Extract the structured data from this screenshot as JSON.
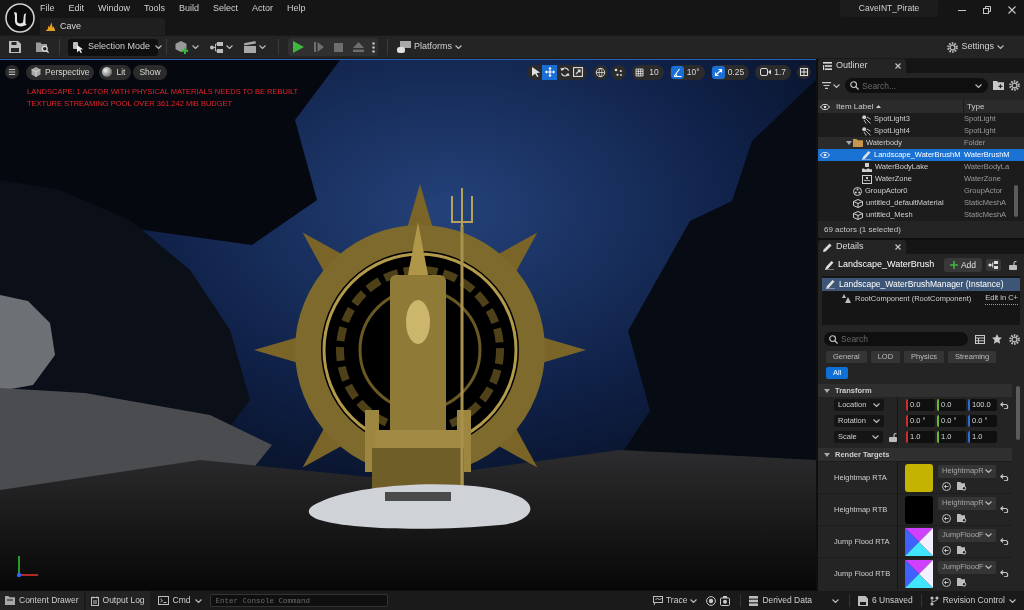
{
  "menu_bar": [
    "File",
    "Edit",
    "Window",
    "Tools",
    "Build",
    "Select",
    "Actor",
    "Help"
  ],
  "document_tab": {
    "label": "Cave"
  },
  "project_name": "CaveINT_Pirate",
  "main_toolbar": {
    "mode_dropdown": "Selection Mode",
    "play_controls": [
      {
        "kind": "play",
        "disabled": false
      },
      {
        "kind": "advance",
        "disabled": true
      },
      {
        "kind": "stop",
        "disabled": true
      },
      {
        "kind": "eject",
        "disabled": true
      }
    ],
    "platforms_button": "Platforms",
    "settings_button": "Settings"
  },
  "viewport": {
    "view_button": "Perspective",
    "lighting_button": "Lit",
    "show_button": "Show",
    "transform_tools": [
      {
        "kind": "select",
        "selected": false
      },
      {
        "kind": "translate",
        "selected": true
      },
      {
        "kind": "rotate",
        "selected": false
      },
      {
        "kind": "scale",
        "selected": false
      }
    ],
    "snaps": [
      {
        "kind": "grid",
        "value": "10",
        "on": false
      },
      {
        "kind": "rotation",
        "value": "10°",
        "on": true
      },
      {
        "kind": "scale",
        "value": "0.25",
        "on": true
      }
    ],
    "camera_speed": "1.7",
    "messages": [
      "LANDSCAPE: 1 ACTOR WITH PHYSICAL MATERIALS NEEDS TO BE REBUILT",
      "TEXTURE STREAMING POOL OVER 361.242 MiB BUDGET"
    ]
  },
  "outliner": {
    "tab": "Outliner",
    "search": {
      "placeholder": "Search..."
    },
    "columns": [
      "Item Label",
      "Type"
    ],
    "rows": [
      {
        "children": [
          {
            "label": "SpotLight3",
            "type": "SpotLight",
            "kind": "light",
            "selected": false
          },
          {
            "label": "SpotLight4",
            "type": "SpotLight",
            "kind": "light",
            "selected": false
          }
        ]
      },
      {
        "label": "Waterbody",
        "type": "Folder",
        "kind": "folder",
        "expanded": true,
        "selected": false,
        "children": [
          {
            "label": "Landscape_WaterBrushM",
            "type": "WaterBrushM",
            "kind": "brush",
            "selected": true
          },
          {
            "label": "WaterBodyLake",
            "type": "WaterBodyLa",
            "kind": "water_body",
            "selected": false
          },
          {
            "label": "WaterZone",
            "type": "WaterZone",
            "kind": "zone",
            "selected": false
          }
        ]
      },
      {
        "label": "GroupActor0",
        "type": "GroupActor",
        "kind": "group",
        "selected": false
      },
      {
        "label": "untitled_defaultMaterial",
        "type": "StaticMeshA",
        "kind": "mesh",
        "selected": false
      },
      {
        "label": "untitled_Mesh",
        "type": "StaticMeshA",
        "kind": "mesh",
        "selected": false
      }
    ],
    "footer": "69 actors (1 selected)"
  },
  "details": {
    "tab": "Details",
    "actor_name": "Landscape_WaterBrush",
    "add_button": "Add",
    "components": [
      {
        "label": "Landscape_WaterBrushManager (Instance)",
        "selected": true,
        "children": [
          {
            "label": "RootComponent (RootComponent)",
            "selected": false,
            "link": "Edit in C+"
          }
        ]
      }
    ],
    "search": {
      "placeholder": "Search"
    },
    "filters": [
      {
        "label": "General",
        "selected": false
      },
      {
        "label": "LOD",
        "selected": false
      },
      {
        "label": "Physics",
        "selected": false
      },
      {
        "label": "Streaming",
        "selected": false
      },
      {
        "label": "All",
        "selected": true
      }
    ],
    "sections": [
      {
        "title": "Transform",
        "expanded": true,
        "rows": [
          {
            "kind": "vector",
            "label": "Location",
            "values": [
              "0.0",
              "0.0",
              "100.0"
            ],
            "modified": true
          },
          {
            "kind": "vector",
            "label": "Rotation",
            "values": [
              "0.0 °",
              "0.0 °",
              "0.0 °"
            ],
            "modified": false
          },
          {
            "kind": "vector",
            "label": "Scale",
            "values": [
              "1.0",
              "1.0",
              "1.0"
            ],
            "locked": false,
            "modified": false
          }
        ]
      },
      {
        "title": "Render Targets",
        "expanded": true,
        "rows": [
          {
            "kind": "texture",
            "label": "Heightmap RTA",
            "asset": "HeightmapR",
            "thumbnail": {
              "kind": "solid",
              "color": "#c4b400"
            },
            "modified": true
          },
          {
            "kind": "texture",
            "label": "Heightmap RTB",
            "asset": "HeightmapR",
            "thumbnail": {
              "kind": "solid",
              "color": "#000000"
            },
            "modified": true
          },
          {
            "kind": "texture",
            "label": "Jump Flood RTA",
            "asset": "JumpFloodF",
            "thumbnail": {
              "kind": "gradient"
            },
            "modified": true
          },
          {
            "kind": "texture",
            "label": "Jump Flood RTB",
            "asset": "JumpFloodF",
            "thumbnail": {
              "kind": "gradient"
            },
            "modified": true
          }
        ]
      }
    ]
  },
  "status_bar": {
    "content_drawer": "Content Drawer",
    "output_log": "Output Log",
    "command_dropdown": "Cmd",
    "console": {
      "placeholder": "Enter Console Command"
    },
    "trace": "Trace",
    "derived_data": "Derived Data",
    "unsaved": "6 Unsaved",
    "revision_control": "Revision Control"
  }
}
